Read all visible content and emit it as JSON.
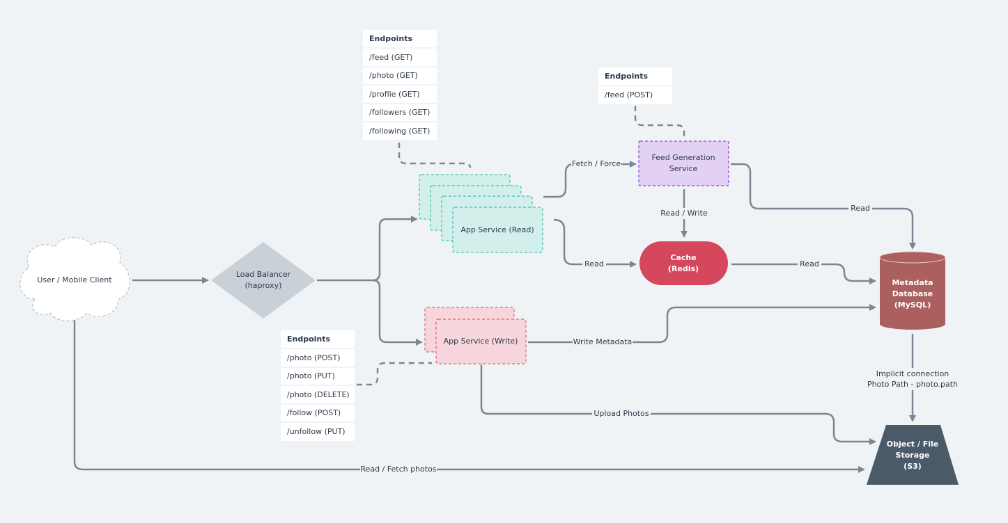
{
  "colors": {
    "background": "#f0f3f6",
    "edge": "#7a8694",
    "read_service_fill": "#d2efec",
    "read_service_border": "#20b39a",
    "write_service_fill": "#f6d6dc",
    "write_service_border": "#e0435b",
    "feed_service_fill": "#e3d1f3",
    "feed_service_border": "#7a1fd6",
    "cache": "#d4475c",
    "database": "#ab5f5f",
    "storage": "#4a5a68",
    "load_balancer": "#c8d0d8"
  },
  "nodes": {
    "client": "User / Mobile Client",
    "load_balancer": [
      "Load Balancer",
      "(haproxy)"
    ],
    "app_read": "App Service (Read)",
    "app_write": "App Service (Write)",
    "feed": [
      "Feed Generation",
      "Service"
    ],
    "cache": [
      "Cache",
      "(Redis)"
    ],
    "database": [
      "Metadata",
      "Database",
      "(MySQL)"
    ],
    "storage": [
      "Object / File",
      "Storage",
      "(S3)"
    ]
  },
  "endpoint_tables": {
    "read": {
      "header": "Endpoints",
      "rows": [
        "/feed (GET)",
        "/photo (GET)",
        "/profile (GET)",
        "/followers (GET)",
        "/following (GET)"
      ]
    },
    "feed": {
      "header": "Endpoints",
      "rows": [
        "/feed (POST)"
      ]
    },
    "write": {
      "header": "Endpoints",
      "rows": [
        "/photo (POST)",
        "/photo (PUT)",
        "/photo (DELETE)",
        "/follow (POST)",
        "/unfollow (PUT)"
      ]
    }
  },
  "edges": {
    "fetch_force": "Fetch / Force",
    "read_cache": "Read",
    "read_write": "Read / Write",
    "feed_db": "Read",
    "cache_db": "Read",
    "write_metadata": "Write Metadata",
    "implicit": [
      "Implicit connection",
      "Photo Path - photo.path"
    ],
    "upload": "Upload Photos",
    "read_fetch": "Read / Fetch photos"
  }
}
